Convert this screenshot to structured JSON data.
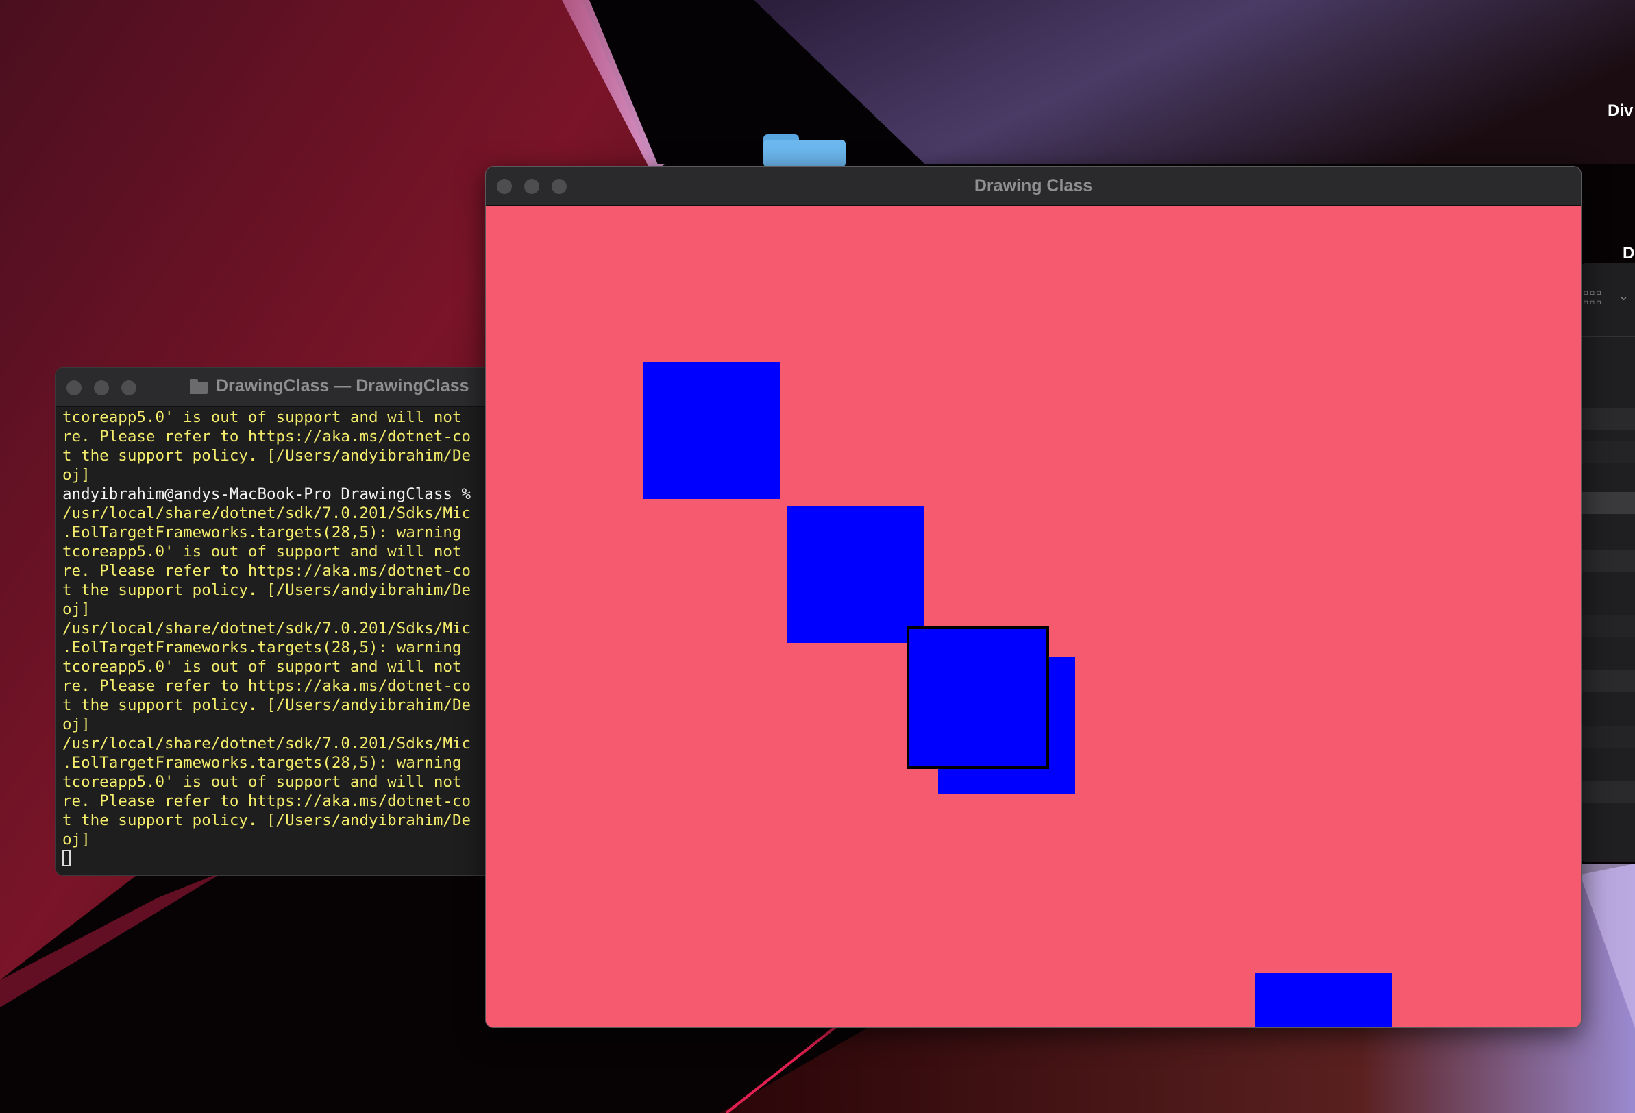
{
  "desktop": {
    "labels": [
      "Div",
      "D"
    ],
    "folder_icon": "folder-icon"
  },
  "terminal": {
    "title": "DrawingClass — DrawingClass",
    "lines": [
      {
        "text": "tcoreapp5.0' is out of support and will not ",
        "kind": "warn"
      },
      {
        "text": "re. Please refer to https://aka.ms/dotnet-co",
        "kind": "warn"
      },
      {
        "text": "t the support policy. [/Users/andyibrahim/De",
        "kind": "warn"
      },
      {
        "text": "oj]",
        "kind": "warn"
      },
      {
        "text": "andyibrahim@andys-MacBook-Pro DrawingClass %",
        "kind": "prompt"
      },
      {
        "text": "/usr/local/share/dotnet/sdk/7.0.201/Sdks/Mic",
        "kind": "warn"
      },
      {
        "text": ".EolTargetFrameworks.targets(28,5): warning ",
        "kind": "warn"
      },
      {
        "text": "tcoreapp5.0' is out of support and will not ",
        "kind": "warn"
      },
      {
        "text": "re. Please refer to https://aka.ms/dotnet-co",
        "kind": "warn"
      },
      {
        "text": "t the support policy. [/Users/andyibrahim/De",
        "kind": "warn"
      },
      {
        "text": "oj]",
        "kind": "warn"
      },
      {
        "text": "/usr/local/share/dotnet/sdk/7.0.201/Sdks/Mic",
        "kind": "warn"
      },
      {
        "text": ".EolTargetFrameworks.targets(28,5): warning ",
        "kind": "warn"
      },
      {
        "text": "tcoreapp5.0' is out of support and will not ",
        "kind": "warn"
      },
      {
        "text": "re. Please refer to https://aka.ms/dotnet-co",
        "kind": "warn"
      },
      {
        "text": "t the support policy. [/Users/andyibrahim/De",
        "kind": "warn"
      },
      {
        "text": "oj]",
        "kind": "warn"
      },
      {
        "text": "/usr/local/share/dotnet/sdk/7.0.201/Sdks/Mic",
        "kind": "warn"
      },
      {
        "text": ".EolTargetFrameworks.targets(28,5): warning ",
        "kind": "warn"
      },
      {
        "text": "tcoreapp5.0' is out of support and will not ",
        "kind": "warn"
      },
      {
        "text": "re. Please refer to https://aka.ms/dotnet-co",
        "kind": "warn"
      },
      {
        "text": "t the support policy. [/Users/andyibrahim/De",
        "kind": "warn"
      },
      {
        "text": "oj]",
        "kind": "warn"
      }
    ],
    "colors": {
      "output": "#f4ec6b",
      "prompt": "#f2f2f2",
      "background": "#1e1e1e"
    }
  },
  "drawing_window": {
    "title": "Drawing Class",
    "colors": {
      "canvas": "#f55a6f",
      "square": "#0000ff",
      "outline": "#000000"
    },
    "square_count": 5
  }
}
